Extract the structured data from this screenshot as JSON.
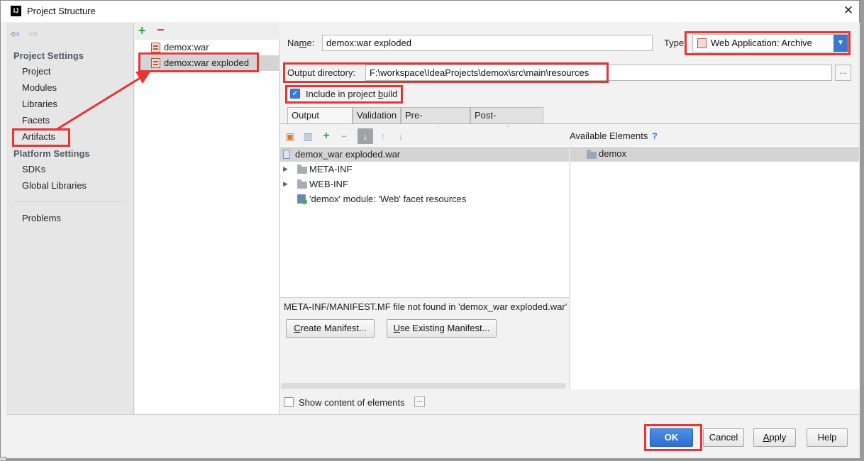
{
  "window": {
    "title": "Project Structure",
    "icon_letters": "IJ"
  },
  "left": {
    "back_icon": "back-arrow-icon",
    "forward_icon": "forward-arrow-icon",
    "project_settings_heading": "Project Settings",
    "project_settings_items": [
      "Project",
      "Modules",
      "Libraries",
      "Facets",
      "Artifacts"
    ],
    "platform_settings_heading": "Platform Settings",
    "platform_settings_items": [
      "SDKs",
      "Global Libraries"
    ],
    "problems": "Problems",
    "selected": "Artifacts"
  },
  "artifacts": {
    "add_icon": "+",
    "remove_icon": "−",
    "items": [
      "demox:war",
      "demox:war exploded"
    ],
    "selected": "demox:war exploded"
  },
  "form": {
    "name_label": "Name:",
    "name_value": "demox:war exploded",
    "type_label": "Type:",
    "type_value": "Web Application: Archive",
    "output_dir_label": "Output directory:",
    "output_dir_value": "F:\\workspace\\IdeaProjects\\demox\\src\\main\\resources",
    "browse_label": "...",
    "include_label": "Include in project build",
    "include_checked": true
  },
  "tabs": [
    "Output Layout",
    "Validation",
    "Pre-processing",
    "Post-processing"
  ],
  "active_tab": "Output Layout",
  "layout": {
    "toolbar_icons": [
      "new-folder-icon",
      "archive-icon",
      "add-icon",
      "remove-icon",
      "sort-icon",
      "move-up-icon",
      "move-down-icon"
    ],
    "root": "demox_war exploded.war",
    "children": [
      {
        "label": "META-INF",
        "expandable": true
      },
      {
        "label": "WEB-INF",
        "expandable": true
      },
      {
        "label": "'demox' module: 'Web' facet resources",
        "expandable": false
      }
    ],
    "available_heading": "Available Elements",
    "available_help": "?",
    "available_items": [
      "demox"
    ],
    "message": "META-INF/MANIFEST.MF file not found in 'demox_war exploded.war'",
    "create_manifest": "Create Manifest...",
    "use_existing_manifest": "Use Existing Manifest...",
    "show_content_label": "Show content of elements",
    "show_content_checked": false,
    "show_content_dots": "..."
  },
  "buttons": {
    "ok": "OK",
    "cancel": "Cancel",
    "apply": "Apply",
    "help": "Help"
  },
  "colors": {
    "highlight": "#e53535",
    "selection": "#d4d4d4",
    "accent": "#3d76cc"
  }
}
